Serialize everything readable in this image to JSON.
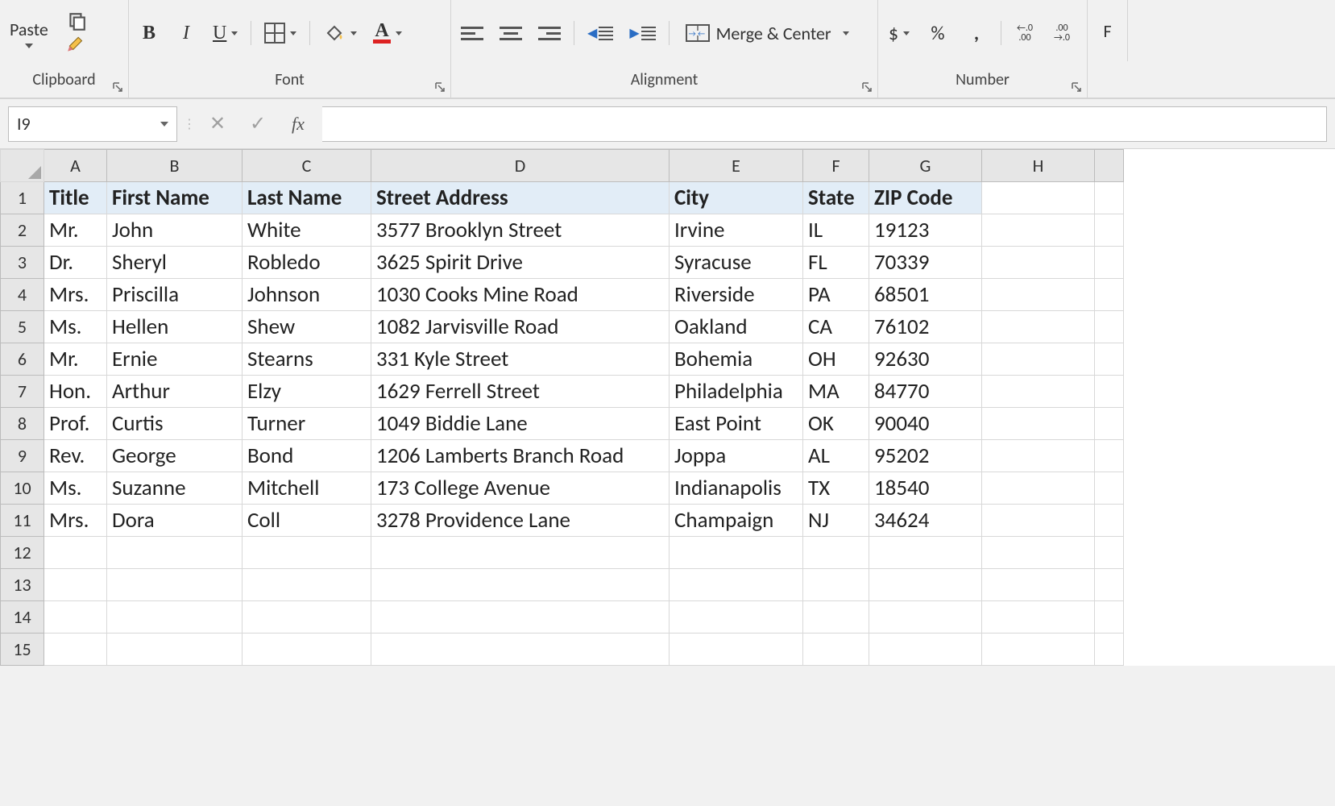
{
  "ribbon": {
    "clipboard": {
      "paste": "Paste",
      "label": "Clipboard"
    },
    "font": {
      "label": "Font",
      "bold": "B",
      "italic": "I",
      "underline": "U",
      "font_color_letter": "A"
    },
    "alignment": {
      "label": "Alignment",
      "merge_center": "Merge & Center"
    },
    "number": {
      "label": "Number",
      "currency": "$",
      "percent": "%",
      "comma": ","
    }
  },
  "formula_bar": {
    "name_box": "I9",
    "fx": "fx",
    "formula": ""
  },
  "columns": [
    "A",
    "B",
    "C",
    "D",
    "E",
    "F",
    "G",
    "H"
  ],
  "row_numbers": [
    "1",
    "2",
    "3",
    "4",
    "5",
    "6",
    "7",
    "8",
    "9",
    "10",
    "11",
    "12",
    "13",
    "14",
    "15"
  ],
  "headers": {
    "A": "Title",
    "B": "First Name",
    "C": "Last Name",
    "D": "Street Address",
    "E": "City",
    "F": "State",
    "G": "ZIP Code"
  },
  "data": [
    {
      "A": "Mr.",
      "B": "John",
      "C": "White",
      "D": "3577 Brooklyn Street",
      "E": "Irvine",
      "F": "IL",
      "G": "19123"
    },
    {
      "A": "Dr.",
      "B": "Sheryl",
      "C": "Robledo",
      "D": "3625 Spirit Drive",
      "E": "Syracuse",
      "F": "FL",
      "G": "70339"
    },
    {
      "A": "Mrs.",
      "B": "Priscilla",
      "C": "Johnson",
      "D": "1030 Cooks Mine Road",
      "E": "Riverside",
      "F": "PA",
      "G": "68501"
    },
    {
      "A": "Ms.",
      "B": "Hellen",
      "C": "Shew",
      "D": "1082 Jarvisville Road",
      "E": "Oakland",
      "F": "CA",
      "G": "76102"
    },
    {
      "A": "Mr.",
      "B": "Ernie",
      "C": "Stearns",
      "D": "331 Kyle Street",
      "E": "Bohemia",
      "F": "OH",
      "G": "92630"
    },
    {
      "A": "Hon.",
      "B": "Arthur",
      "C": "Elzy",
      "D": "1629 Ferrell Street",
      "E": "Philadelphia",
      "F": "MA",
      "G": "84770"
    },
    {
      "A": "Prof.",
      "B": "Curtis",
      "C": "Turner",
      "D": "1049 Biddie Lane",
      "E": "East Point",
      "F": "OK",
      "G": "90040"
    },
    {
      "A": "Rev.",
      "B": "George",
      "C": "Bond",
      "D": "1206 Lamberts Branch Road",
      "E": "Joppa",
      "F": "AL",
      "G": "95202"
    },
    {
      "A": "Ms.",
      "B": "Suzanne",
      "C": "Mitchell",
      "D": "173 College Avenue",
      "E": "Indianapolis",
      "F": "TX",
      "G": "18540"
    },
    {
      "A": "Mrs.",
      "B": "Dora",
      "C": "Coll",
      "D": "3278 Providence Lane",
      "E": "Champaign",
      "F": "NJ",
      "G": "34624"
    }
  ]
}
